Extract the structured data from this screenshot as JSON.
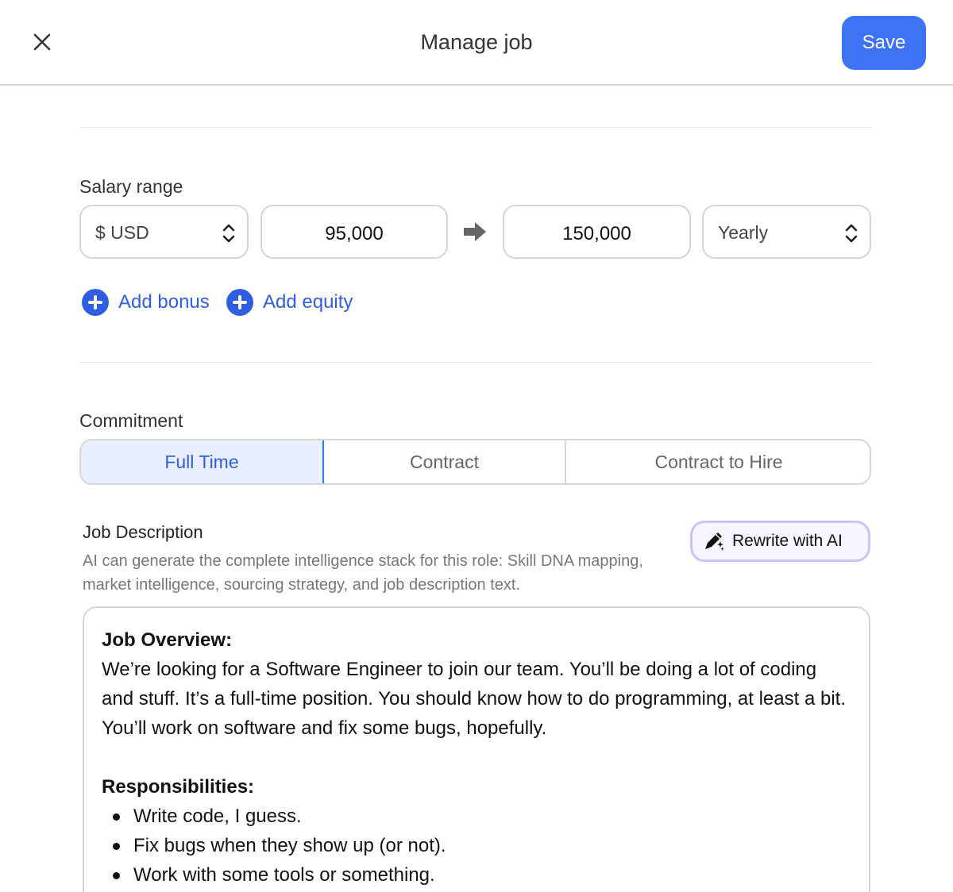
{
  "header": {
    "title": "Manage job",
    "save_label": "Save",
    "close_icon": "close-icon"
  },
  "salary": {
    "label": "Salary range",
    "currency": "$ USD",
    "min": "95,000",
    "max": "150,000",
    "period": "Yearly",
    "add_bonus": "Add bonus",
    "add_equity": "Add equity"
  },
  "commitment": {
    "label": "Commitment",
    "options": [
      "Full Time",
      "Contract",
      "Contract to Hire"
    ],
    "selected": "Full Time"
  },
  "job_description": {
    "title": "Job Description",
    "help": "AI can generate the complete intelligence stack for this role: Skill DNA mapping, market intelligence, sourcing strategy, and job description text.",
    "rewrite_label": "Rewrite with AI",
    "overview_heading": "Job Overview:",
    "overview_text": "We’re looking for a Software Engineer to join our team. You’ll be doing a lot of coding and stuff. It’s a full-time position. You should know how to do programming, at least a bit. You’ll work on software and fix some bugs, hopefully.",
    "responsibilities_heading": "Responsibilities:",
    "responsibilities": [
      "Write code, I guess.",
      "Fix bugs when they show up (or not).",
      "Work with some tools or something."
    ]
  },
  "colors": {
    "accent": "#3f73f5",
    "link": "#2f5fe0",
    "selected_bg": "#e9efff",
    "ai_border": "#cbc3f5"
  }
}
